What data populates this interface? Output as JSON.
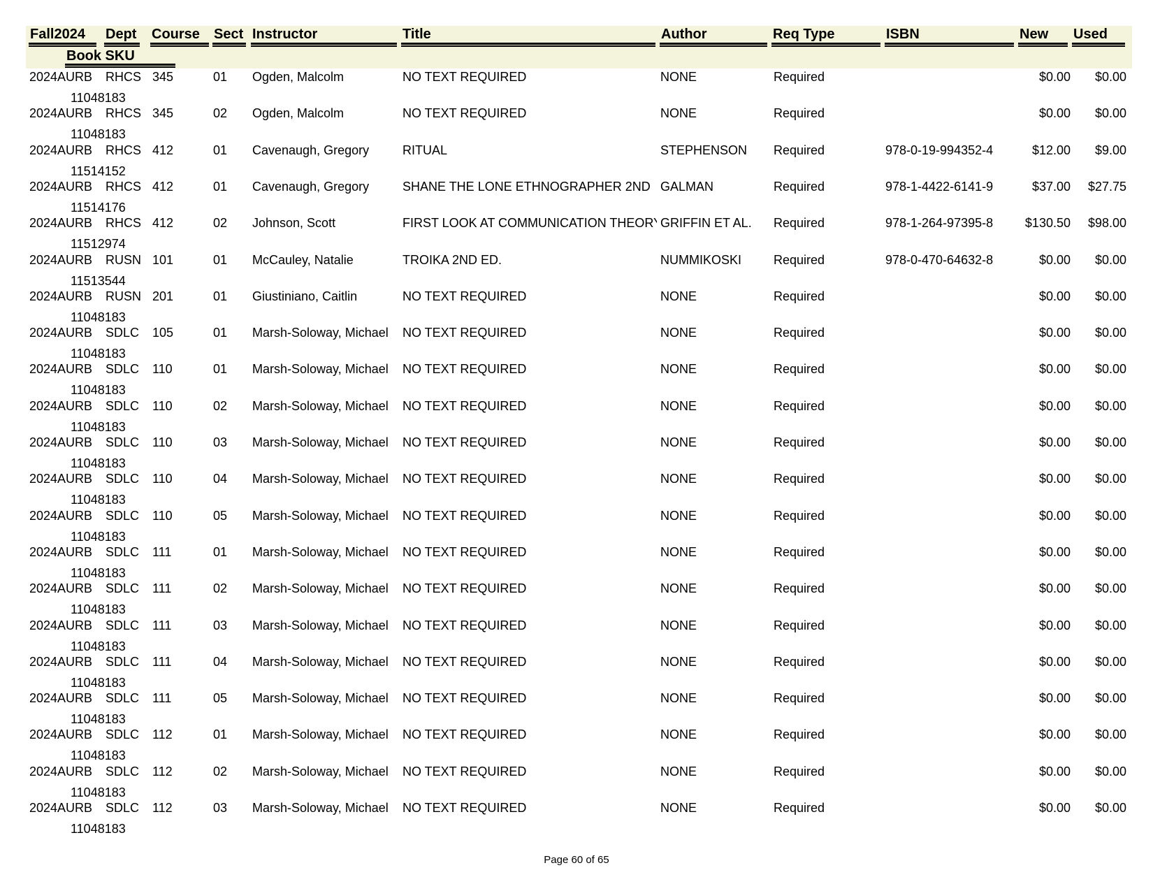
{
  "header": {
    "term": "Fall2024",
    "dept": "Dept",
    "course": "Course",
    "sect": "Sect",
    "instructor": "Instructor",
    "title": "Title",
    "author": "Author",
    "req_type": "Req Type",
    "isbn": "ISBN",
    "new": "New",
    "used": "Used",
    "book_sku": "Book SKU"
  },
  "rows": [
    {
      "term": "2024AURB",
      "dept": "RHCS",
      "course": "345",
      "sect": "01",
      "instructor": "Ogden, Malcolm",
      "title": "NO TEXT REQUIRED",
      "author": "NONE",
      "req": "Required",
      "isbn": "",
      "new": "$0.00",
      "used": "$0.00",
      "sku": "11048183"
    },
    {
      "term": "2024AURB",
      "dept": "RHCS",
      "course": "345",
      "sect": "02",
      "instructor": "Ogden, Malcolm",
      "title": "NO TEXT REQUIRED",
      "author": "NONE",
      "req": "Required",
      "isbn": "",
      "new": "$0.00",
      "used": "$0.00",
      "sku": "11048183"
    },
    {
      "term": "2024AURB",
      "dept": "RHCS",
      "course": "412",
      "sect": "01",
      "instructor": "Cavenaugh, Gregory",
      "title": "RITUAL",
      "author": "STEPHENSON",
      "req": "Required",
      "isbn": "978-0-19-994352-4",
      "new": "$12.00",
      "used": "$9.00",
      "sku": "11514152"
    },
    {
      "term": "2024AURB",
      "dept": "RHCS",
      "course": "412",
      "sect": "01",
      "instructor": "Cavenaugh, Gregory",
      "title": "SHANE THE LONE ETHNOGRAPHER 2ND",
      "author": "GALMAN",
      "req": "Required",
      "isbn": "978-1-4422-6141-9",
      "new": "$37.00",
      "used": "$27.75",
      "sku": "11514176"
    },
    {
      "term": "2024AURB",
      "dept": "RHCS",
      "course": "412",
      "sect": "02",
      "instructor": "Johnson, Scott",
      "title": "FIRST LOOK AT COMMUNICATION THEORY",
      "author": "GRIFFIN ET AL.",
      "req": "Required",
      "isbn": "978-1-264-97395-8",
      "new": "$130.50",
      "used": "$98.00",
      "sku": "11512974"
    },
    {
      "term": "2024AURB",
      "dept": "RUSN",
      "course": "101",
      "sect": "01",
      "instructor": "McCauley, Natalie",
      "title": "TROIKA 2ND ED.",
      "author": "NUMMIKOSKI",
      "req": "Required",
      "isbn": "978-0-470-64632-8",
      "new": "$0.00",
      "used": "$0.00",
      "sku": "11513544"
    },
    {
      "term": "2024AURB",
      "dept": "RUSN",
      "course": "201",
      "sect": "01",
      "instructor": "Giustiniano, Caitlin",
      "title": "NO TEXT REQUIRED",
      "author": "NONE",
      "req": "Required",
      "isbn": "",
      "new": "$0.00",
      "used": "$0.00",
      "sku": "11048183"
    },
    {
      "term": "2024AURB",
      "dept": "SDLC",
      "course": "105",
      "sect": "01",
      "instructor": "Marsh-Soloway, Michael",
      "title": "NO TEXT REQUIRED",
      "author": "NONE",
      "req": "Required",
      "isbn": "",
      "new": "$0.00",
      "used": "$0.00",
      "sku": "11048183"
    },
    {
      "term": "2024AURB",
      "dept": "SDLC",
      "course": "110",
      "sect": "01",
      "instructor": "Marsh-Soloway, Michael",
      "title": "NO TEXT REQUIRED",
      "author": "NONE",
      "req": "Required",
      "isbn": "",
      "new": "$0.00",
      "used": "$0.00",
      "sku": "11048183"
    },
    {
      "term": "2024AURB",
      "dept": "SDLC",
      "course": "110",
      "sect": "02",
      "instructor": "Marsh-Soloway, Michael",
      "title": "NO TEXT REQUIRED",
      "author": "NONE",
      "req": "Required",
      "isbn": "",
      "new": "$0.00",
      "used": "$0.00",
      "sku": "11048183"
    },
    {
      "term": "2024AURB",
      "dept": "SDLC",
      "course": "110",
      "sect": "03",
      "instructor": "Marsh-Soloway, Michael",
      "title": "NO TEXT REQUIRED",
      "author": "NONE",
      "req": "Required",
      "isbn": "",
      "new": "$0.00",
      "used": "$0.00",
      "sku": "11048183"
    },
    {
      "term": "2024AURB",
      "dept": "SDLC",
      "course": "110",
      "sect": "04",
      "instructor": "Marsh-Soloway, Michael",
      "title": "NO TEXT REQUIRED",
      "author": "NONE",
      "req": "Required",
      "isbn": "",
      "new": "$0.00",
      "used": "$0.00",
      "sku": "11048183"
    },
    {
      "term": "2024AURB",
      "dept": "SDLC",
      "course": "110",
      "sect": "05",
      "instructor": "Marsh-Soloway, Michael",
      "title": "NO TEXT REQUIRED",
      "author": "NONE",
      "req": "Required",
      "isbn": "",
      "new": "$0.00",
      "used": "$0.00",
      "sku": "11048183"
    },
    {
      "term": "2024AURB",
      "dept": "SDLC",
      "course": "111",
      "sect": "01",
      "instructor": "Marsh-Soloway, Michael",
      "title": "NO TEXT REQUIRED",
      "author": "NONE",
      "req": "Required",
      "isbn": "",
      "new": "$0.00",
      "used": "$0.00",
      "sku": "11048183"
    },
    {
      "term": "2024AURB",
      "dept": "SDLC",
      "course": "111",
      "sect": "02",
      "instructor": "Marsh-Soloway, Michael",
      "title": "NO TEXT REQUIRED",
      "author": "NONE",
      "req": "Required",
      "isbn": "",
      "new": "$0.00",
      "used": "$0.00",
      "sku": "11048183"
    },
    {
      "term": "2024AURB",
      "dept": "SDLC",
      "course": "111",
      "sect": "03",
      "instructor": "Marsh-Soloway, Michael",
      "title": "NO TEXT REQUIRED",
      "author": "NONE",
      "req": "Required",
      "isbn": "",
      "new": "$0.00",
      "used": "$0.00",
      "sku": "11048183"
    },
    {
      "term": "2024AURB",
      "dept": "SDLC",
      "course": "111",
      "sect": "04",
      "instructor": "Marsh-Soloway, Michael",
      "title": "NO TEXT REQUIRED",
      "author": "NONE",
      "req": "Required",
      "isbn": "",
      "new": "$0.00",
      "used": "$0.00",
      "sku": "11048183"
    },
    {
      "term": "2024AURB",
      "dept": "SDLC",
      "course": "111",
      "sect": "05",
      "instructor": "Marsh-Soloway, Michael",
      "title": "NO TEXT REQUIRED",
      "author": "NONE",
      "req": "Required",
      "isbn": "",
      "new": "$0.00",
      "used": "$0.00",
      "sku": "11048183"
    },
    {
      "term": "2024AURB",
      "dept": "SDLC",
      "course": "112",
      "sect": "01",
      "instructor": "Marsh-Soloway, Michael",
      "title": "NO TEXT REQUIRED",
      "author": "NONE",
      "req": "Required",
      "isbn": "",
      "new": "$0.00",
      "used": "$0.00",
      "sku": "11048183"
    },
    {
      "term": "2024AURB",
      "dept": "SDLC",
      "course": "112",
      "sect": "02",
      "instructor": "Marsh-Soloway, Michael",
      "title": "NO TEXT REQUIRED",
      "author": "NONE",
      "req": "Required",
      "isbn": "",
      "new": "$0.00",
      "used": "$0.00",
      "sku": "11048183"
    },
    {
      "term": "2024AURB",
      "dept": "SDLC",
      "course": "112",
      "sect": "03",
      "instructor": "Marsh-Soloway, Michael",
      "title": "NO TEXT REQUIRED",
      "author": "NONE",
      "req": "Required",
      "isbn": "",
      "new": "$0.00",
      "used": "$0.00",
      "sku": "11048183"
    }
  ],
  "footer": {
    "page_label": "Page 60 of 65"
  }
}
